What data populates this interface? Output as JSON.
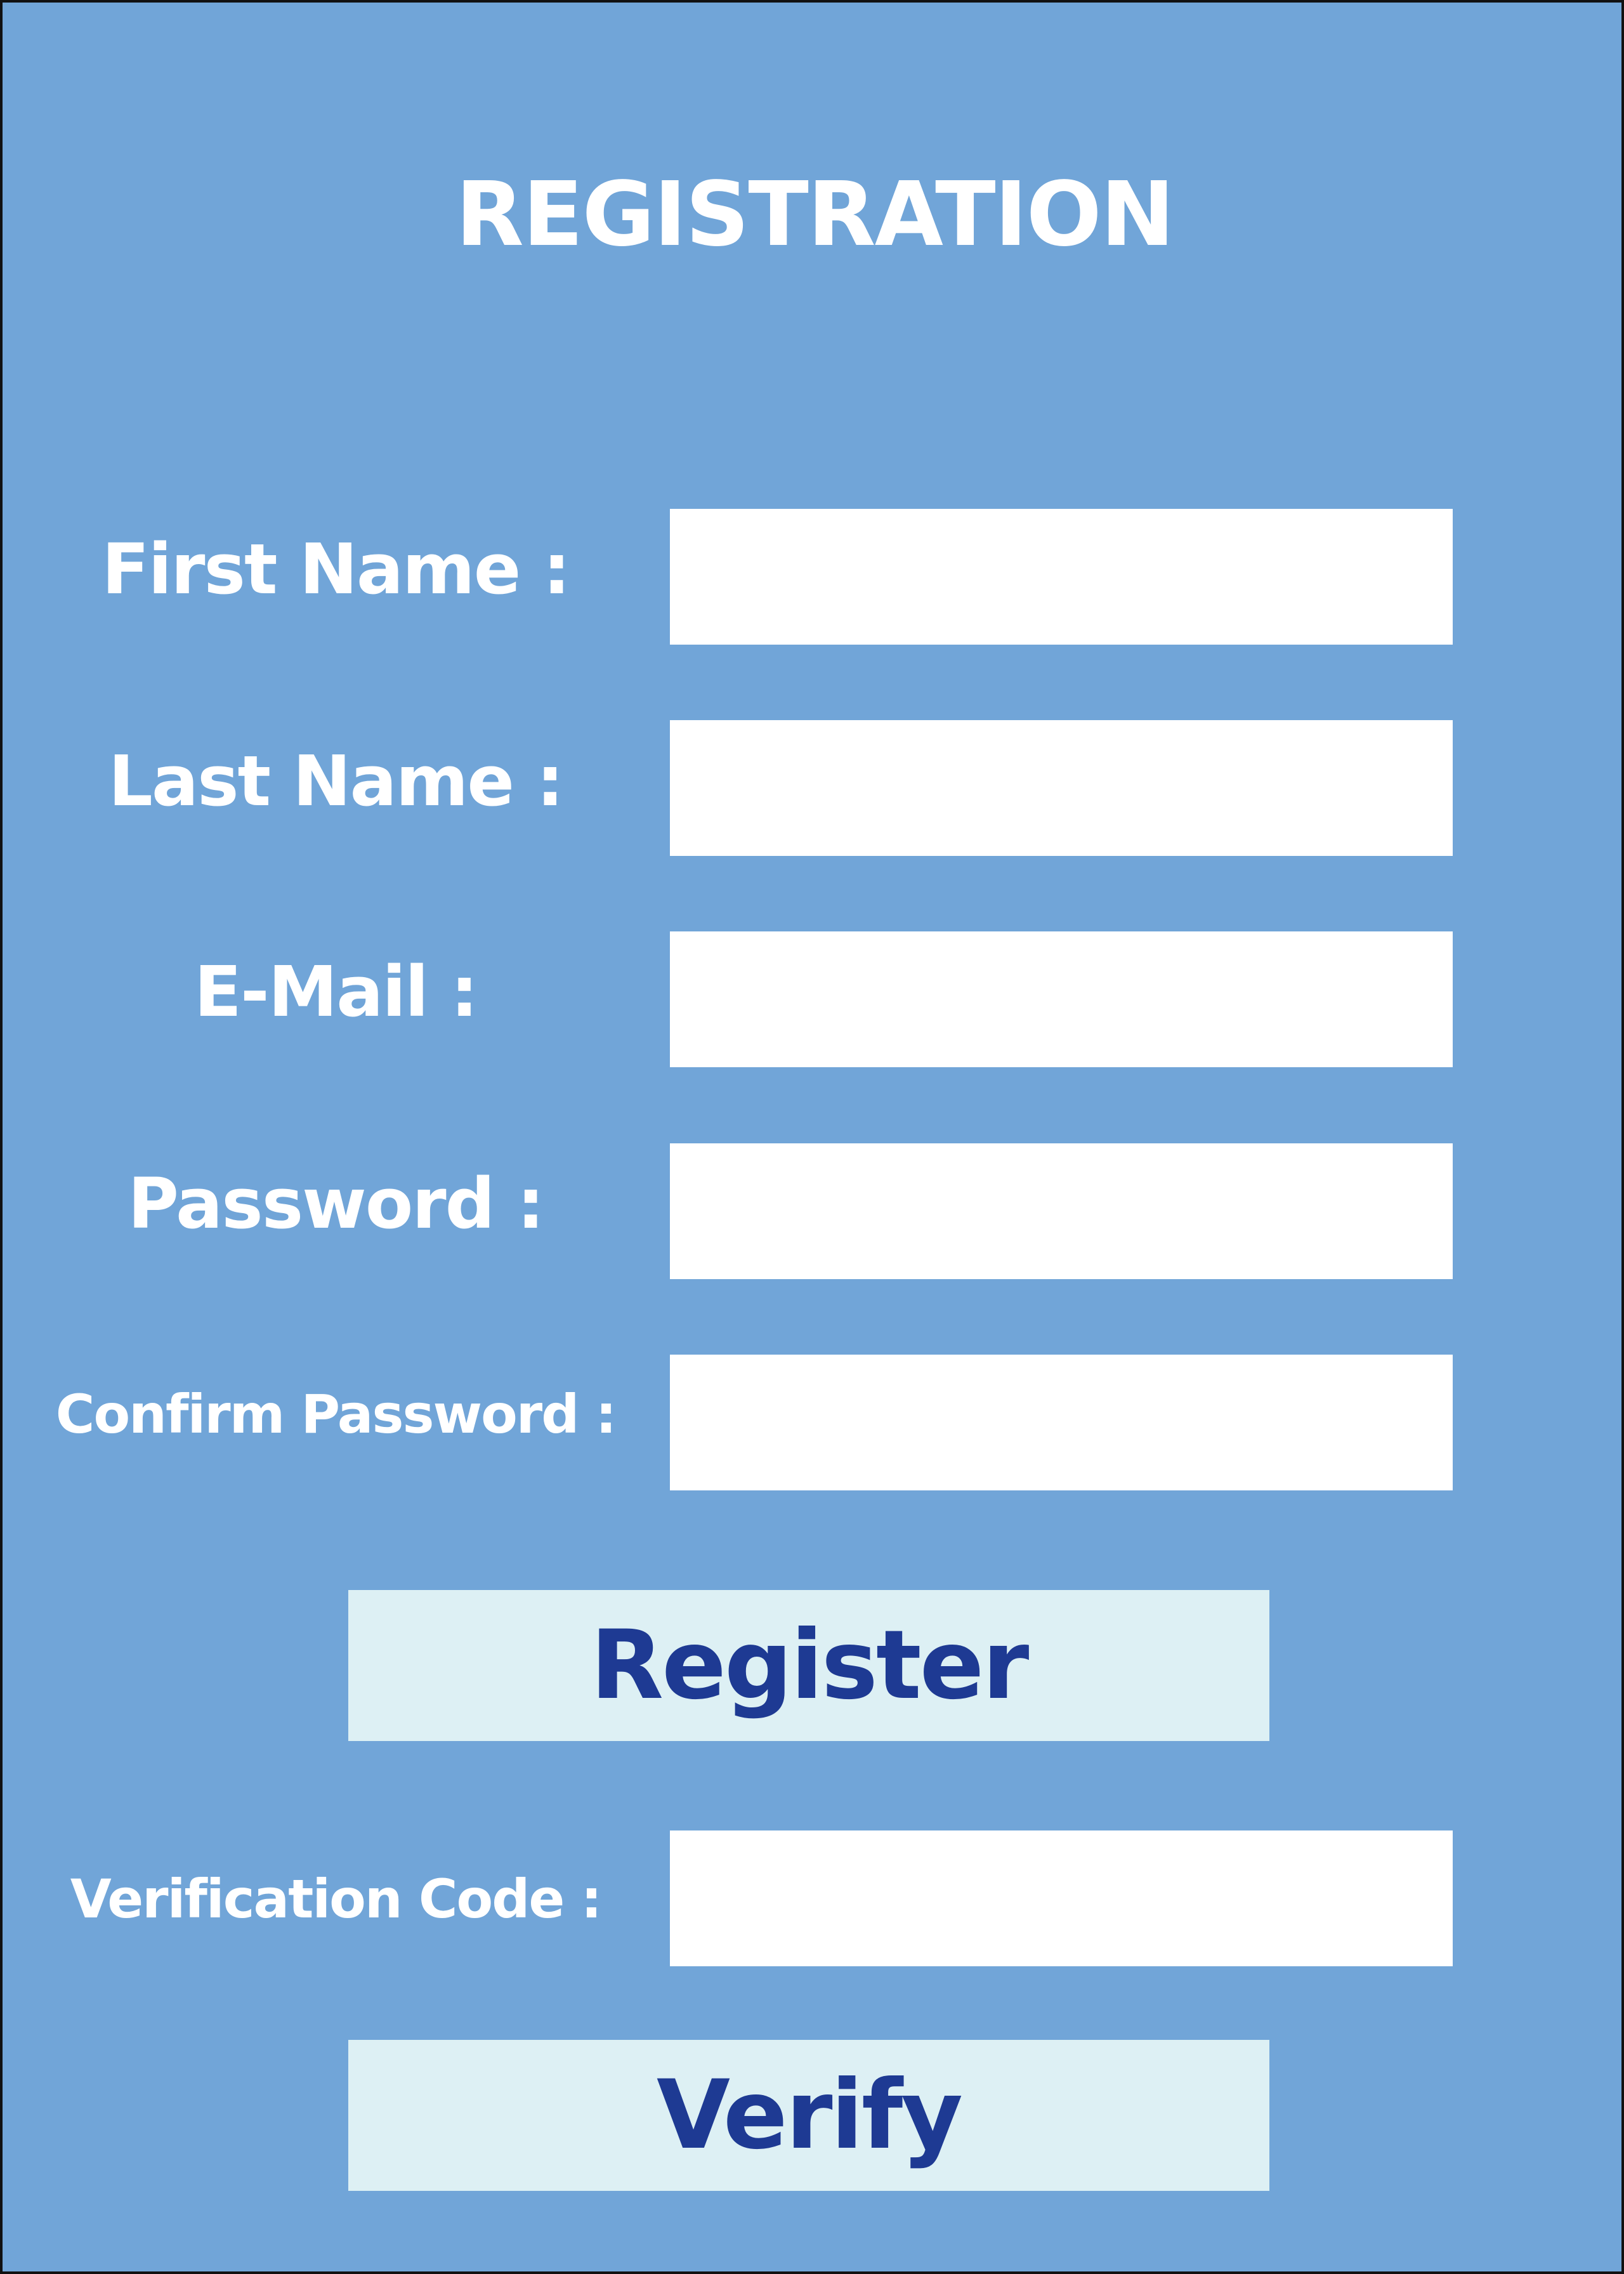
{
  "form": {
    "title": "REGISTRATION",
    "fields": [
      {
        "label": "First Name :",
        "value": ""
      },
      {
        "label": "Last Name :",
        "value": ""
      },
      {
        "label": "E-Mail :",
        "value": ""
      },
      {
        "label": "Password :",
        "value": ""
      },
      {
        "label": "Confirm Password :",
        "value": ""
      }
    ],
    "register_label": "Register",
    "verification": {
      "label": "Verification Code :",
      "value": ""
    },
    "verify_label": "Verify"
  },
  "colors": {
    "background": "#71a5d8",
    "field": "#ffffff",
    "button": "#ddf0f4",
    "button_text": "#1e3a93",
    "label_text": "#ffffff"
  }
}
